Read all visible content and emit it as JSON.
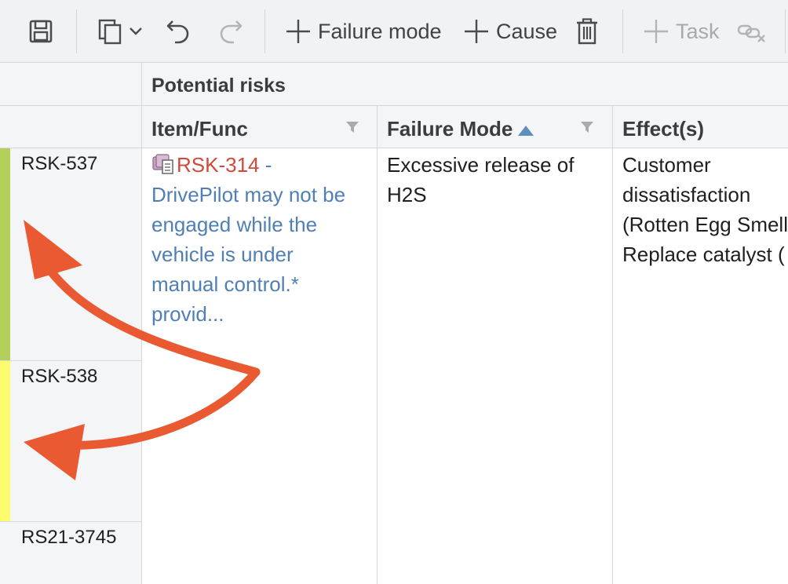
{
  "toolbar": {
    "save_icon": "save-icon",
    "copy_icon": "copy-icon",
    "undo_icon": "undo-icon",
    "redo_icon": "redo-icon",
    "add_failure_mode_label": "Failure mode",
    "add_cause_label": "Cause",
    "delete_icon": "trash-icon",
    "add_task_label": "Task",
    "unlink_icon": "unlink-icon"
  },
  "grid": {
    "group_header": "Potential risks",
    "columns": [
      {
        "label": "Item/Func",
        "filter": true
      },
      {
        "label": "Failure Mode",
        "sorted": "ascending",
        "filter": true
      },
      {
        "label": "Effect(s)"
      }
    ],
    "rows": [
      {
        "id": "RSK-537",
        "stripe_color": "#b5cf5b",
        "item_link_id": "RSK-314",
        "item_link_sep": " -",
        "item_lines": [
          "DrivePilot may not be",
          "engaged while the",
          "vehicle is under",
          "manual control.*",
          "provid..."
        ],
        "failure_mode_lines": [
          "Excessive release of",
          "H2S"
        ],
        "effect_lines": [
          "Customer",
          "dissatisfaction",
          "(Rotten Egg Smell",
          "Replace catalyst ("
        ]
      },
      {
        "id": "RSK-538",
        "stripe_color": "#fcfc6c"
      },
      {
        "id": "RS21-3745",
        "stripe_color": ""
      }
    ]
  },
  "annotation": {
    "color": "#ea5a32"
  }
}
